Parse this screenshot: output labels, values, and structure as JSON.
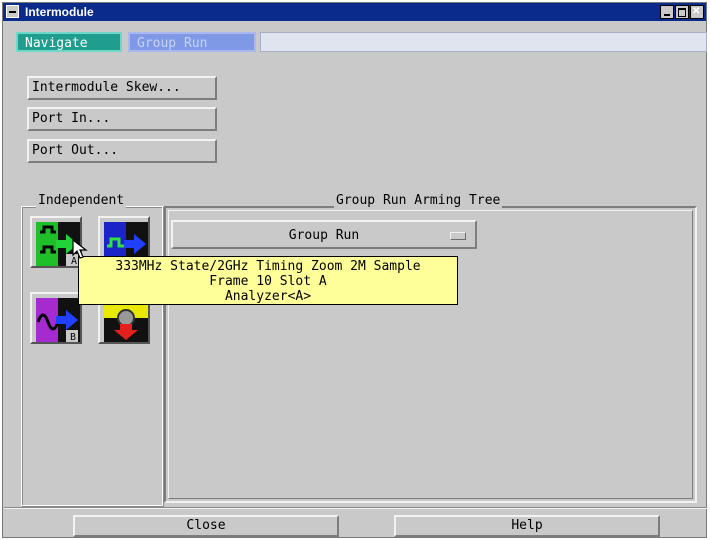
{
  "window": {
    "title": "Intermodule"
  },
  "menu": {
    "navigate": "Navigate",
    "group_run": "Group Run"
  },
  "buttons": {
    "skew": "Intermodule Skew...",
    "port_in": "Port In...",
    "port_out": "Port Out...",
    "close": "Close",
    "help": "Help"
  },
  "independent": {
    "label": "Independent",
    "modules": [
      {
        "letter": "A",
        "icon": "state-timing-analyzer-icon"
      },
      {
        "letter": "",
        "icon": "timing-analyzer-icon"
      },
      {
        "letter": "B",
        "icon": "oscilloscope-icon"
      },
      {
        "letter": "",
        "icon": "emulation-probe-icon"
      }
    ]
  },
  "arming_tree": {
    "label": "Group Run Arming Tree",
    "dropdown_value": "Group Run"
  },
  "tooltip": {
    "line1": "333MHz State/2GHz Timing Zoom 2M Sample",
    "line2": "Frame 10 Slot A",
    "line3": "Analyzer<A>"
  },
  "colors": {
    "title_bar": "#0a2a8c",
    "navigate_tab": "#1f9e8f",
    "group_run_tab": "#7f99e6",
    "tooltip_bg": "#ffff99"
  }
}
